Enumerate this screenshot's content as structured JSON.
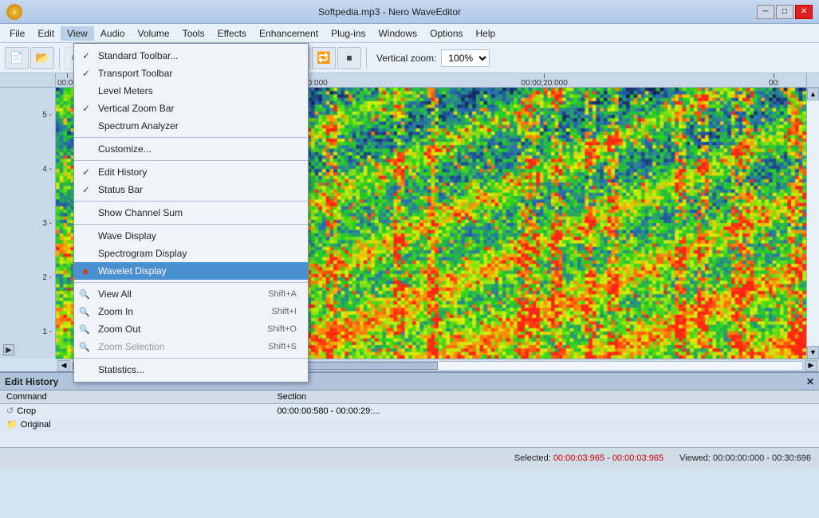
{
  "titlebar": {
    "title": "Softpedia.mp3 - Nero WaveEditor",
    "min_btn": "─",
    "max_btn": "□",
    "close_btn": "✕"
  },
  "menubar": {
    "items": [
      "File",
      "Edit",
      "View",
      "Audio",
      "Volume",
      "Tools",
      "Effects",
      "Enhancement",
      "Plug-ins",
      "Windows",
      "Options",
      "Help"
    ]
  },
  "toolbar": {
    "zoom_label": "Vertical zoom:",
    "zoom_value": "100%"
  },
  "view_menu": {
    "items": [
      {
        "label": "Standard Toolbar...",
        "checked": true,
        "bullet": false,
        "shortcut": "",
        "disabled": false,
        "icon": false
      },
      {
        "label": "Transport Toolbar",
        "checked": true,
        "bullet": false,
        "shortcut": "",
        "disabled": false,
        "icon": false
      },
      {
        "label": "Level Meters",
        "checked": false,
        "bullet": false,
        "shortcut": "",
        "disabled": false,
        "icon": false
      },
      {
        "label": "Vertical Zoom Bar",
        "checked": true,
        "bullet": false,
        "shortcut": "",
        "disabled": false,
        "icon": false
      },
      {
        "label": "Spectrum Analyzer",
        "checked": false,
        "bullet": false,
        "shortcut": "",
        "disabled": false,
        "icon": false
      },
      {
        "separator": true
      },
      {
        "label": "Customize...",
        "checked": false,
        "bullet": false,
        "shortcut": "",
        "disabled": false,
        "icon": false
      },
      {
        "separator": true
      },
      {
        "label": "Edit History",
        "checked": true,
        "bullet": false,
        "shortcut": "",
        "disabled": false,
        "icon": false
      },
      {
        "label": "Status Bar",
        "checked": true,
        "bullet": false,
        "shortcut": "",
        "disabled": false,
        "icon": false
      },
      {
        "separator": true
      },
      {
        "label": "Show Channel Sum",
        "checked": false,
        "bullet": false,
        "shortcut": "",
        "disabled": false,
        "icon": false
      },
      {
        "separator": true
      },
      {
        "label": "Wave Display",
        "checked": false,
        "bullet": false,
        "shortcut": "",
        "disabled": false,
        "icon": false
      },
      {
        "label": "Spectrogram Display",
        "checked": false,
        "bullet": false,
        "shortcut": "",
        "disabled": false,
        "icon": false
      },
      {
        "label": "Wavelet Display",
        "checked": false,
        "bullet": true,
        "shortcut": "",
        "disabled": false,
        "active": true,
        "icon": false
      },
      {
        "separator": true
      },
      {
        "label": "View All",
        "checked": false,
        "bullet": false,
        "shortcut": "Shift+A",
        "disabled": false,
        "icon": true
      },
      {
        "label": "Zoom In",
        "checked": false,
        "bullet": false,
        "shortcut": "Shift+I",
        "disabled": false,
        "icon": true
      },
      {
        "label": "Zoom Out",
        "checked": false,
        "bullet": false,
        "shortcut": "Shift+O",
        "disabled": false,
        "icon": true
      },
      {
        "label": "Zoom Selection",
        "checked": false,
        "bullet": false,
        "shortcut": "Shift+S",
        "disabled": true,
        "icon": true
      },
      {
        "separator": true
      },
      {
        "label": "Statistics...",
        "checked": false,
        "bullet": false,
        "shortcut": "",
        "disabled": false,
        "icon": false
      }
    ]
  },
  "ruler": {
    "marks": [
      "00:00",
      "00:00;10:000",
      "00:00;20:000",
      "00:"
    ]
  },
  "y_axis": {
    "marks": [
      "5",
      "4",
      "3",
      "2",
      "1"
    ]
  },
  "edit_history": {
    "title": "Edit History",
    "columns": [
      "Command",
      "Section"
    ],
    "rows": [
      {
        "command": "Crop",
        "section": "00:00:00:580 - 00:00:29:...",
        "icon": "↺"
      },
      {
        "command": "Original",
        "section": "",
        "icon": "📁"
      }
    ]
  },
  "statusbar": {
    "selected_label": "Selected:",
    "selected_value": "00:00:03:965 - 00:00:03:965",
    "viewed_label": "Viewed:",
    "viewed_value": "00:00:00:000 - 00:30:696"
  }
}
